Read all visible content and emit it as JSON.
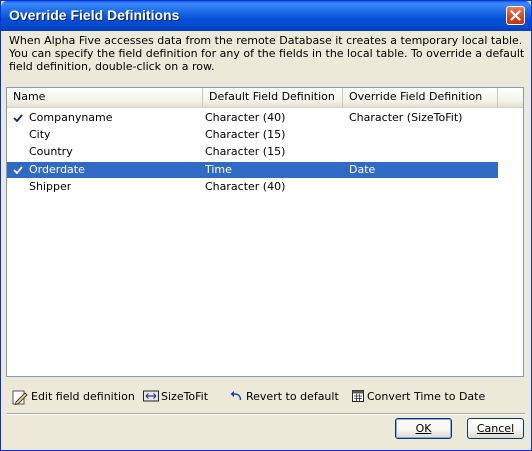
{
  "window": {
    "title": "Override Field Definitions"
  },
  "description": "When Alpha Five accesses data from the remote Database it creates a temporary local table. You can specify the field definition for any of the fields in the local table. To override a default field definition, double-click on a row.",
  "list": {
    "columns": [
      "Name",
      "Default Field Definition",
      "Override Field Definition"
    ],
    "rows": [
      {
        "checked": true,
        "name": "Companyname",
        "default": "Character (40)",
        "override": "Character (SizeToFit)",
        "selected": false
      },
      {
        "checked": false,
        "name": "City",
        "default": "Character (15)",
        "override": "",
        "selected": false
      },
      {
        "checked": false,
        "name": "Country",
        "default": "Character (15)",
        "override": "",
        "selected": false
      },
      {
        "checked": true,
        "name": "Orderdate",
        "default": "Time",
        "override": "Date",
        "selected": true
      },
      {
        "checked": false,
        "name": "Shipper",
        "default": "Character (40)",
        "override": "",
        "selected": false
      }
    ]
  },
  "toolbar": {
    "edit_label": "Edit field definition",
    "sizetofit_label": "SizeToFit",
    "revert_label": "Revert to default",
    "convert_label": "Convert Time to Date"
  },
  "buttons": {
    "ok_label": "OK",
    "cancel_label": "Cancel"
  },
  "icons": {
    "close": "close-icon",
    "check": "checkmark-icon",
    "edit": "edit-pencil-icon",
    "sizetofit": "resize-horizontal-icon",
    "revert": "undo-icon",
    "convert": "calendar-icon"
  },
  "colors": {
    "title_bar": "#0550d8",
    "selection": "#316ac5",
    "dialog_bg": "#ece9d8"
  }
}
